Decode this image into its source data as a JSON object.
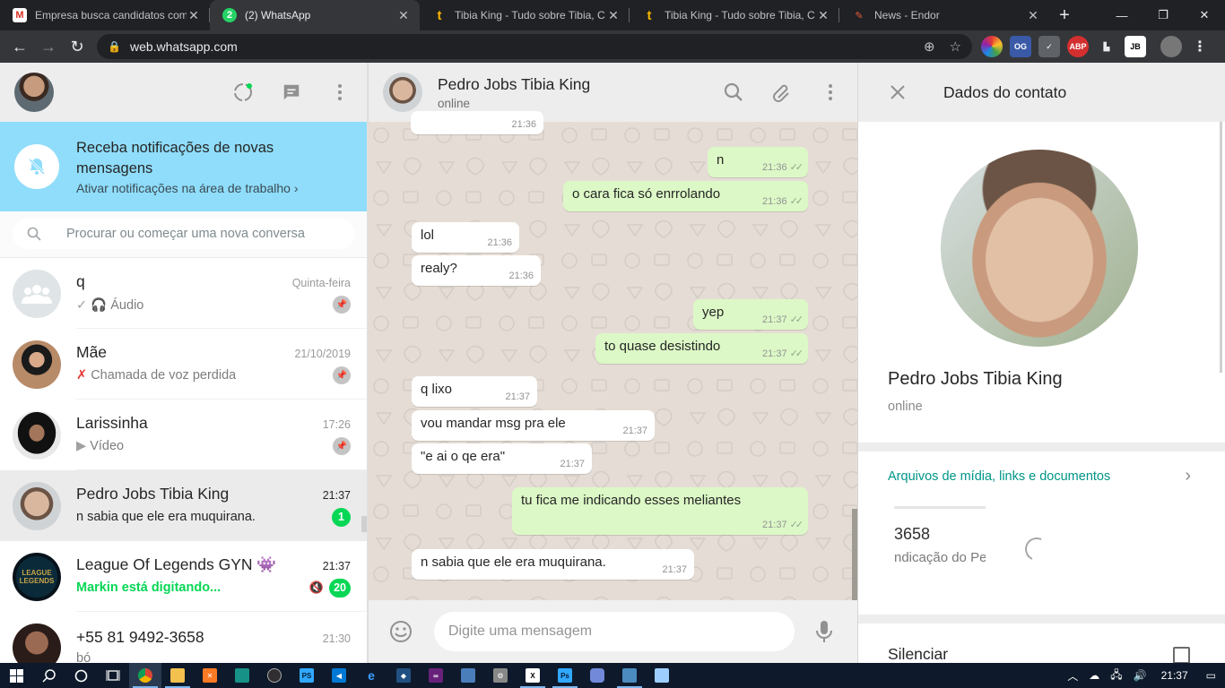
{
  "browser": {
    "tabs": [
      {
        "title": "Empresa busca candidatos com",
        "favicon": "gmail-icon",
        "active": false
      },
      {
        "title": "(2) WhatsApp",
        "favicon": "whatsapp-icon",
        "active": true
      },
      {
        "title": "Tibia King - Tudo sobre Tibia, C",
        "favicon": "tibiaking-icon",
        "active": false
      },
      {
        "title": "Tibia King - Tudo sobre Tibia, C",
        "favicon": "tibiaking-icon",
        "active": false
      },
      {
        "title": "News - Endor",
        "favicon": "endor-icon",
        "active": false
      }
    ],
    "close_glyph": "✕",
    "new_tab_glyph": "+",
    "url": "web.whatsapp.com",
    "colors": {
      "tab_bar": "#202124",
      "toolbar": "#35363a"
    },
    "extensions": [
      "OG",
      "ABP",
      "JB"
    ]
  },
  "left": {
    "notification": {
      "title": "Receba notificações de novas mensagens",
      "subtitle": "Ativar notificações na área de trabalho"
    },
    "search_placeholder": "Procurar ou começar uma nova conversa",
    "chats": [
      {
        "name": "q",
        "time": "Quinta-feira",
        "last": "Áudio",
        "prefix": "✓ 🎧",
        "pinned": true
      },
      {
        "name": "Mãe",
        "time": "21/10/2019",
        "last": "Chamada de voz perdida",
        "prefix": "missed-call-icon",
        "pinned": true
      },
      {
        "name": "Larissinha",
        "time": "17:26",
        "last": "Vídeo",
        "prefix": "video-icon",
        "pinned": true
      },
      {
        "name": "Pedro Jobs Tibia King",
        "time": "21:37",
        "last": "n sabia que ele era muquirana.",
        "unread": "1",
        "selected": true
      },
      {
        "name": "League Of Legends GYN",
        "time": "21:37",
        "last": "Markin está digitando...",
        "unread": "20",
        "muted": true
      },
      {
        "name": "+55 81 9492-3658",
        "time": "21:30",
        "last": "bó"
      }
    ]
  },
  "conversation": {
    "contact": "Pedro Jobs Tibia King",
    "status": "online",
    "composer_placeholder": "Digite uma mensagem",
    "messages": [
      {
        "dir": "in",
        "text": "",
        "time": "21:36"
      },
      {
        "dir": "out",
        "text": "n",
        "time": "21:36"
      },
      {
        "dir": "out",
        "text": "o cara fica só enrrolando",
        "time": "21:36"
      },
      {
        "dir": "in",
        "text": "lol",
        "time": "21:36"
      },
      {
        "dir": "in",
        "text": "realy?",
        "time": "21:36"
      },
      {
        "dir": "out",
        "text": "yep",
        "time": "21:37"
      },
      {
        "dir": "out",
        "text": "to quase desistindo",
        "time": "21:37"
      },
      {
        "dir": "in",
        "text": "q lixo",
        "time": "21:37"
      },
      {
        "dir": "in",
        "text": "vou mandar msg pra ele",
        "time": "21:37"
      },
      {
        "dir": "in",
        "text": "\"e ai o qe era\"",
        "time": "21:37"
      },
      {
        "dir": "out",
        "text": "tu fica me indicando esses meliantes",
        "time": "21:37"
      },
      {
        "dir": "in",
        "text": "n sabia que ele era muquirana.",
        "time": "21:37"
      }
    ]
  },
  "contact_info": {
    "title": "Dados do contato",
    "name": "Pedro Jobs Tibia King",
    "status": "online",
    "media_label": "Arquivos de mídia, links e documentos",
    "media_preview_line1": "3658",
    "media_preview_line2": "ndicação do Pe",
    "silence_label": "Silenciar"
  },
  "taskbar": {
    "time": "21:37",
    "apps": [
      "windows-icon",
      "search-icon",
      "cortana-icon",
      "task-view-icon",
      "chrome-icon",
      "explorer-icon",
      "xampp-icon",
      "gitkraken-icon",
      "obs-icon",
      "photoshop-icon",
      "vscode-icon",
      "edge-icon",
      "sourcetree-icon",
      "visualstudio-icon",
      "sqlmanager-icon",
      "tool-icon",
      "excel-icon",
      "ps-icon",
      "discord-icon",
      "vm-icon",
      "notepad-icon"
    ],
    "ps_label": "PS",
    "xl_label": "X",
    "ps2_label": "Ps"
  }
}
